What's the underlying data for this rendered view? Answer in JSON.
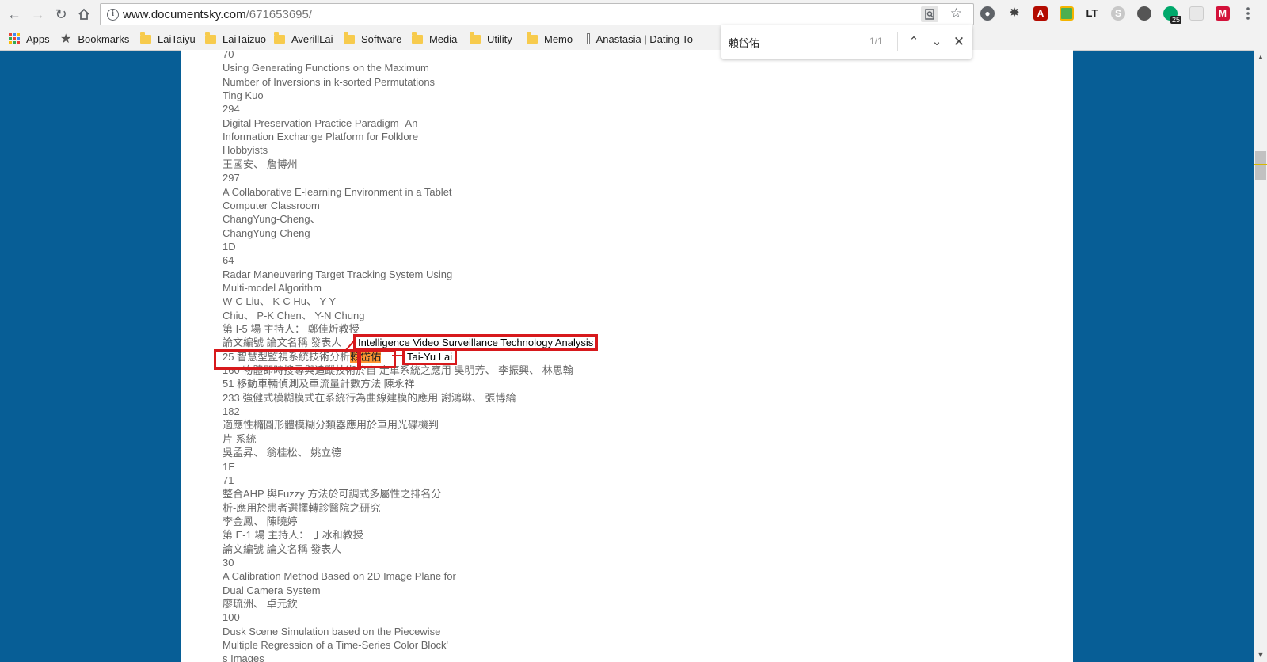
{
  "browser": {
    "url_host": "www.documentsky.com",
    "url_path": "/671653695/"
  },
  "bookmarks": [
    {
      "label": "Apps",
      "icon": "apps-grid-icon"
    },
    {
      "label": "Bookmarks",
      "icon": "star-icon"
    },
    {
      "label": "LaiTaiyu",
      "icon": "folder-icon"
    },
    {
      "label": "LaiTaizuo",
      "icon": "folder-icon"
    },
    {
      "label": "AverillLai",
      "icon": "folder-icon"
    },
    {
      "label": "Software",
      "icon": "folder-icon"
    },
    {
      "label": "Media",
      "icon": "folder-icon"
    },
    {
      "label": "Utility",
      "icon": "folder-icon"
    },
    {
      "label": "Memo",
      "icon": "folder-icon"
    },
    {
      "label": "Anastasia | Dating To",
      "icon": "page-icon"
    }
  ],
  "extensions": {
    "badge_count": "25",
    "lt_label": "LT"
  },
  "find_bar": {
    "query": "賴岱佑",
    "count": "1/1"
  },
  "document": {
    "lines": [
      "70",
      "Using Generating Functions on the Maximum",
      "Number of Inversions in k-sorted Permutations",
      "Ting Kuo",
      "294",
      "Digital Preservation Practice Paradigm -An",
      "Information Exchange Platform for Folklore",
      "Hobbyists",
      "王國安、 詹博州",
      "297",
      "A Collaborative E-learning Environment in a Tablet",
      "Computer Classroom",
      "ChangYung-Cheng、",
      "ChangYung-Cheng",
      "1D",
      "64",
      "Radar Maneuvering Target Tracking System Using",
      "Multi-model Algorithm",
      "W-C Liu、 K-C Hu、 Y-Y",
      "Chiu、 P-K Chen、 Y-N Chung",
      "第 I-5 場 主持人： 鄭佳炘教授",
      "論文編號 論文名稱 發表人",
      "25 智慧型監視系統技術分析",
      "160 物體即時搜尋與追蹤技術於自 走車系統之應用 吳明芳、 李振興、 林思翰",
      "51 移動車輛偵測及車流量計數方法 陳永祥",
      "233 強健式模糊模式在系統行為曲線建模的應用 謝鴻琳、 張博綸",
      "182",
      "適應性橢圓形體模糊分類器應用於車用光碟機判",
      "片 系統",
      "吳孟昇、 翁桂松、 姚立德",
      "1E",
      "71",
      "整合AHP 與Fuzzy 方法於可調式多屬性之排名分",
      "析-應用於患者選擇轉診醫院之研究",
      "李金鳳、 陳曉婷",
      "第 E-1 場 主持人： 丁冰和教授",
      "論文編號 論文名稱 發表人",
      "30",
      "A Calibration Method Based on 2D Image Plane for",
      "Dual Camera System",
      "廖琉洲、 卓元欽",
      "100",
      "Dusk Scene Simulation based on the Piecewise",
      "Multiple Regression of a Time-Series Color Block'",
      "s Images"
    ],
    "highlight_author": "賴岱佑"
  },
  "annotations": {
    "title_translation": "Intelligence Video Surveillance Technology Analysis",
    "author_translation": "Tai-Yu Lai"
  }
}
